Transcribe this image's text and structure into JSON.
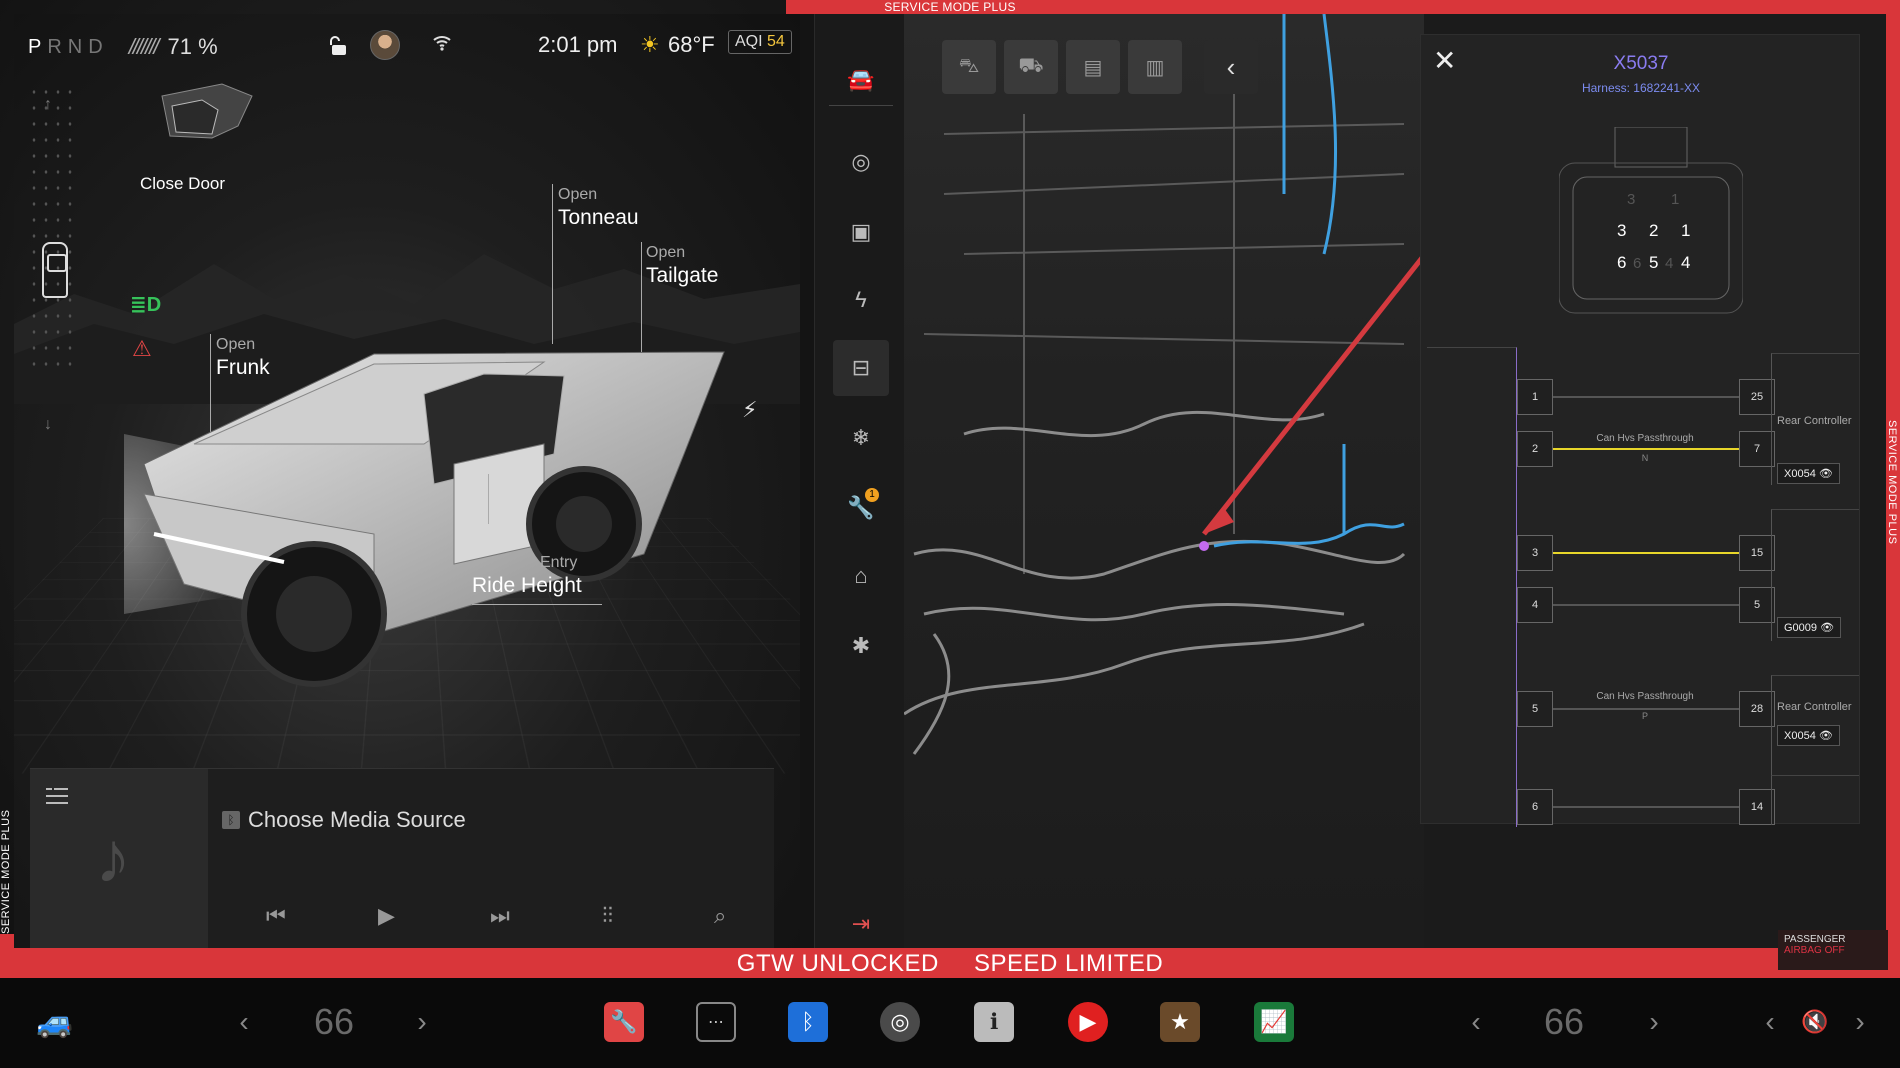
{
  "frame": {
    "top_label": "SERVICE MODE PLUS",
    "side_label": "SERVICE MODE PLUS",
    "bottom_left": "GTW UNLOCKED",
    "bottom_right": "SPEED LIMITED",
    "color": "#d9363a"
  },
  "status": {
    "gear_active": "P",
    "gear_rest": "RND",
    "battery_bars": "///////",
    "battery": "71 %",
    "time": "2:01 pm",
    "temperature": "68°F",
    "aqi_label": "AQI",
    "aqi_value": "54"
  },
  "controls": {
    "close_door": "Close Door",
    "tonneau_action": "Open",
    "tonneau": "Tonneau",
    "tailgate_action": "Open",
    "tailgate": "Tailgate",
    "frunk_action": "Open",
    "frunk": "Frunk",
    "ride_height_mode": "Entry",
    "ride_height": "Ride Height"
  },
  "media": {
    "title": "Choose Media Source"
  },
  "rail": {
    "items": [
      "car-icon",
      "steering-wheel-icon",
      "chip-icon",
      "lightning-icon",
      "battery-tool-icon",
      "snowflake-icon",
      "wrench-icon",
      "seat-icon",
      "airbag-person-icon"
    ],
    "active_index": 4,
    "badge_count": "1"
  },
  "connector": {
    "id": "X5037",
    "harness": "Harness: 1682241-XX",
    "pins_top": [
      "3",
      "2",
      "1"
    ],
    "pins_bottom": [
      "6",
      "5",
      "4"
    ],
    "pins_ghost_top": [
      "3",
      "1"
    ],
    "pins_ghost_bottom": [
      "6",
      "4"
    ],
    "wires": [
      {
        "from": "1",
        "to": "25",
        "label": "",
        "sub": "",
        "yellow": false
      },
      {
        "from": "2",
        "to": "7",
        "label": "Can Hvs Passthrough",
        "sub": "N",
        "yellow": true
      },
      {
        "from": "3",
        "to": "15",
        "label": "",
        "sub": "",
        "yellow": true
      },
      {
        "from": "4",
        "to": "5",
        "label": "",
        "sub": "",
        "yellow": false
      },
      {
        "from": "5",
        "to": "28",
        "label": "Can Hvs Passthrough",
        "sub": "P",
        "yellow": false
      },
      {
        "from": "6",
        "to": "14",
        "label": "",
        "sub": "",
        "yellow": false
      }
    ],
    "controllers": [
      {
        "name": "Rear Controller",
        "id": "X0054"
      },
      {
        "name": "",
        "id": "G0009"
      },
      {
        "name": "Rear Controller",
        "id": "X0054"
      }
    ]
  },
  "airbag": {
    "line1": "PASSENGER",
    "line2": "AIRBAG OFF"
  },
  "dock": {
    "left_temp": "66",
    "right_temp": "66"
  }
}
